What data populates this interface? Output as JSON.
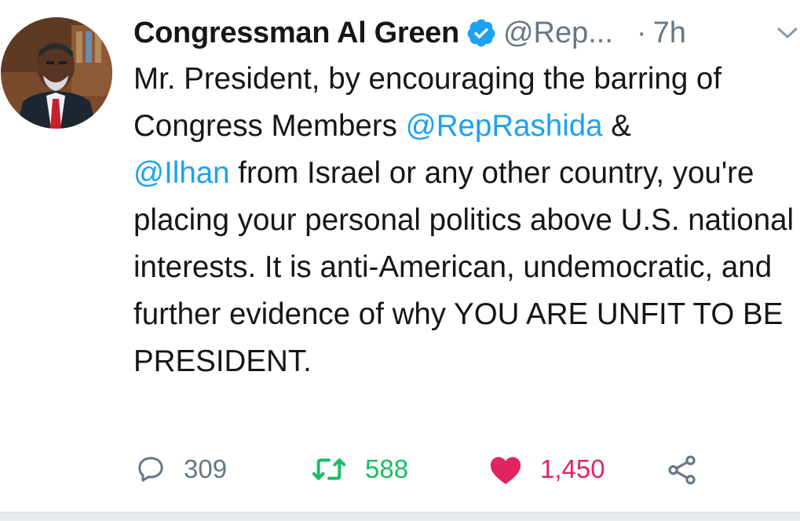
{
  "tweet": {
    "author_name": "Congressman Al Green",
    "handle": "@Rep...",
    "separator": "·",
    "time": "7h",
    "body": {
      "part1": "Mr. President, by encouraging the barring of Congress Members ",
      "mention1": "@RepRashida",
      "part2": " & ",
      "mention2": "@Ilhan",
      "part3": " from Israel or any other country, you're placing your personal politics above U.S. national interests. It is anti-American, undemocratic, and further evidence of why YOU ARE UNFIT TO BE PRESIDENT."
    },
    "actions": {
      "reply_count": "309",
      "retweet_count": "588",
      "like_count": "1,450"
    }
  },
  "icons": {
    "verified": "verified-badge-icon",
    "menu": "chevron-down-icon",
    "reply": "reply-icon",
    "retweet": "retweet-icon",
    "like": "heart-icon",
    "share": "share-icon"
  },
  "colors": {
    "text": "#14171a",
    "secondary": "#657786",
    "link": "#1da1f2",
    "retweet": "#17bf63",
    "like": "#e0245e"
  }
}
